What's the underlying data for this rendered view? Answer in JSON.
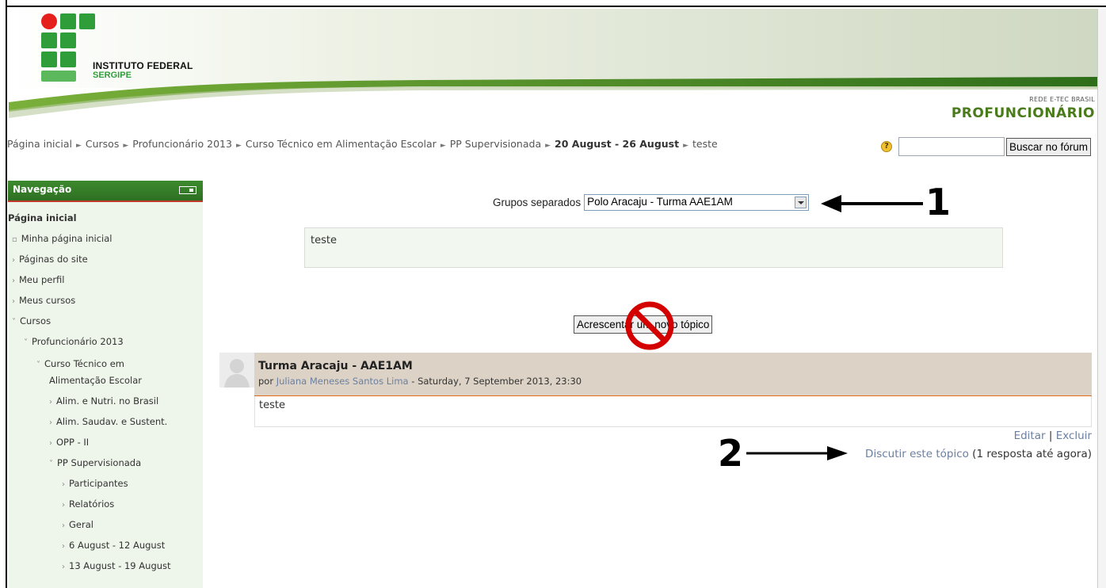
{
  "header": {
    "logo_line1": "INSTITUTO FEDERAL",
    "logo_line2": "SERGIPE",
    "brand_small": "REDE E-TEC BRASIL",
    "brand_big": "PROFUNCIONÁRIO"
  },
  "breadcrumb": [
    {
      "label": "Página inicial",
      "bold": false
    },
    {
      "label": "Cursos",
      "bold": false
    },
    {
      "label": "Profuncionário 2013",
      "bold": false
    },
    {
      "label": "Curso Técnico em Alimentação Escolar",
      "bold": false
    },
    {
      "label": "PP Supervisionada",
      "bold": false
    },
    {
      "label": "20 August - 26 August",
      "bold": true
    },
    {
      "label": "teste",
      "bold": false
    }
  ],
  "search": {
    "button_label": "Buscar no fórum",
    "help_glyph": "?",
    "value": ""
  },
  "nav": {
    "title": "Navegação",
    "items": [
      {
        "label": "Página inicial",
        "bullet": ""
      },
      {
        "label": "Minha página inicial",
        "bullet": "▫"
      },
      {
        "label": "Páginas do site",
        "bullet": "›"
      },
      {
        "label": "Meu perfil",
        "bullet": "›"
      },
      {
        "label": "Meus cursos",
        "bullet": "›"
      },
      {
        "label": "Cursos",
        "bullet": "˅"
      },
      {
        "label": "Profuncionário 2013",
        "bullet": "˅"
      },
      {
        "label": "Curso Técnico em",
        "bullet": "˅"
      },
      {
        "label": "Alimentação Escolar",
        "bullet": ""
      },
      {
        "label": "Alim. e Nutri. no Brasil",
        "bullet": "›"
      },
      {
        "label": "Alim. Saudav. e Sustent.",
        "bullet": "›"
      },
      {
        "label": "OPP - II",
        "bullet": "›"
      },
      {
        "label": "PP Supervisionada",
        "bullet": "˅"
      },
      {
        "label": "Participantes",
        "bullet": "›"
      },
      {
        "label": "Relatórios",
        "bullet": "›"
      },
      {
        "label": "Geral",
        "bullet": "›"
      },
      {
        "label": "6 August - 12 August",
        "bullet": "›"
      },
      {
        "label": "13 August - 19 August",
        "bullet": "›"
      }
    ]
  },
  "forum": {
    "groups_label": "Grupos separados",
    "groups_selected": "Polo Aracaju - Turma AAE1AM",
    "intro": "teste",
    "new_topic_button": "Acrescentar um novo tópico",
    "post": {
      "subject": "Turma Aracaju - AAE1AM",
      "by": "por",
      "author": "Juliana Meneses Santos Lima",
      "date": "Saturday, 7 September 2013, 23:30",
      "body": "teste",
      "edit_link": "Editar",
      "delete_link": "Excluir",
      "discuss_link": "Discutir este tópico",
      "reply_count": "(1 resposta até agora)"
    }
  },
  "annotations": {
    "marker_1": "1",
    "marker_2": "2"
  },
  "colors": {
    "nav_header": "#2e7022",
    "brand": "#4a7b1a",
    "post_header": "#dcd3c6",
    "link": "#6b7fa0",
    "forbidden": "#d40000"
  }
}
